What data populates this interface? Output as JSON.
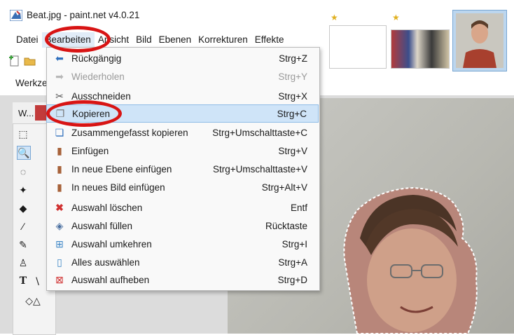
{
  "window": {
    "title": "Beat.jpg - paint.net v4.0.21"
  },
  "menubar": {
    "items": [
      {
        "label": "Datei"
      },
      {
        "label": "Bearbeiten"
      },
      {
        "label": "Ansicht"
      },
      {
        "label": "Bild"
      },
      {
        "label": "Ebenen"
      },
      {
        "label": "Korrekturen"
      },
      {
        "label": "Effekte"
      }
    ]
  },
  "toolbar": {
    "werkzeuge_label": "Werkze"
  },
  "tools_window": {
    "title": "W..."
  },
  "edit_menu": {
    "items": [
      {
        "label": "Rückgängig",
        "shortcut": "Strg+Z",
        "icon": "undo-icon",
        "disabled": false
      },
      {
        "label": "Wiederholen",
        "shortcut": "Strg+Y",
        "icon": "redo-icon",
        "disabled": true
      },
      {
        "label": "Ausschneiden",
        "shortcut": "Strg+X",
        "icon": "scissors-icon",
        "disabled": false
      },
      {
        "label": "Kopieren",
        "shortcut": "Strg+C",
        "icon": "copy-icon",
        "disabled": false,
        "highlighted": true
      },
      {
        "label": "Zusammengefasst kopieren",
        "shortcut": "Strg+Umschalttaste+C",
        "icon": "copy-merged-icon",
        "disabled": false
      },
      {
        "label": "Einfügen",
        "shortcut": "Strg+V",
        "icon": "paste-icon",
        "disabled": false
      },
      {
        "label": "In neue Ebene einfügen",
        "shortcut": "Strg+Umschalttaste+V",
        "icon": "paste-layer-icon",
        "disabled": false
      },
      {
        "label": "In neues Bild einfügen",
        "shortcut": "Strg+Alt+V",
        "icon": "paste-image-icon",
        "disabled": false
      },
      {
        "label": "Auswahl löschen",
        "shortcut": "Entf",
        "icon": "delete-selection-icon",
        "disabled": false
      },
      {
        "label": "Auswahl füllen",
        "shortcut": "Rücktaste",
        "icon": "fill-selection-icon",
        "disabled": false
      },
      {
        "label": "Auswahl umkehren",
        "shortcut": "Strg+I",
        "icon": "invert-selection-icon",
        "disabled": false
      },
      {
        "label": "Alles auswählen",
        "shortcut": "Strg+A",
        "icon": "select-all-icon",
        "disabled": false
      },
      {
        "label": "Auswahl aufheben",
        "shortcut": "Strg+D",
        "icon": "deselect-icon",
        "disabled": false
      }
    ]
  },
  "colors": {
    "annotation_red": "#d81414",
    "highlight": "#cfe4f8"
  }
}
